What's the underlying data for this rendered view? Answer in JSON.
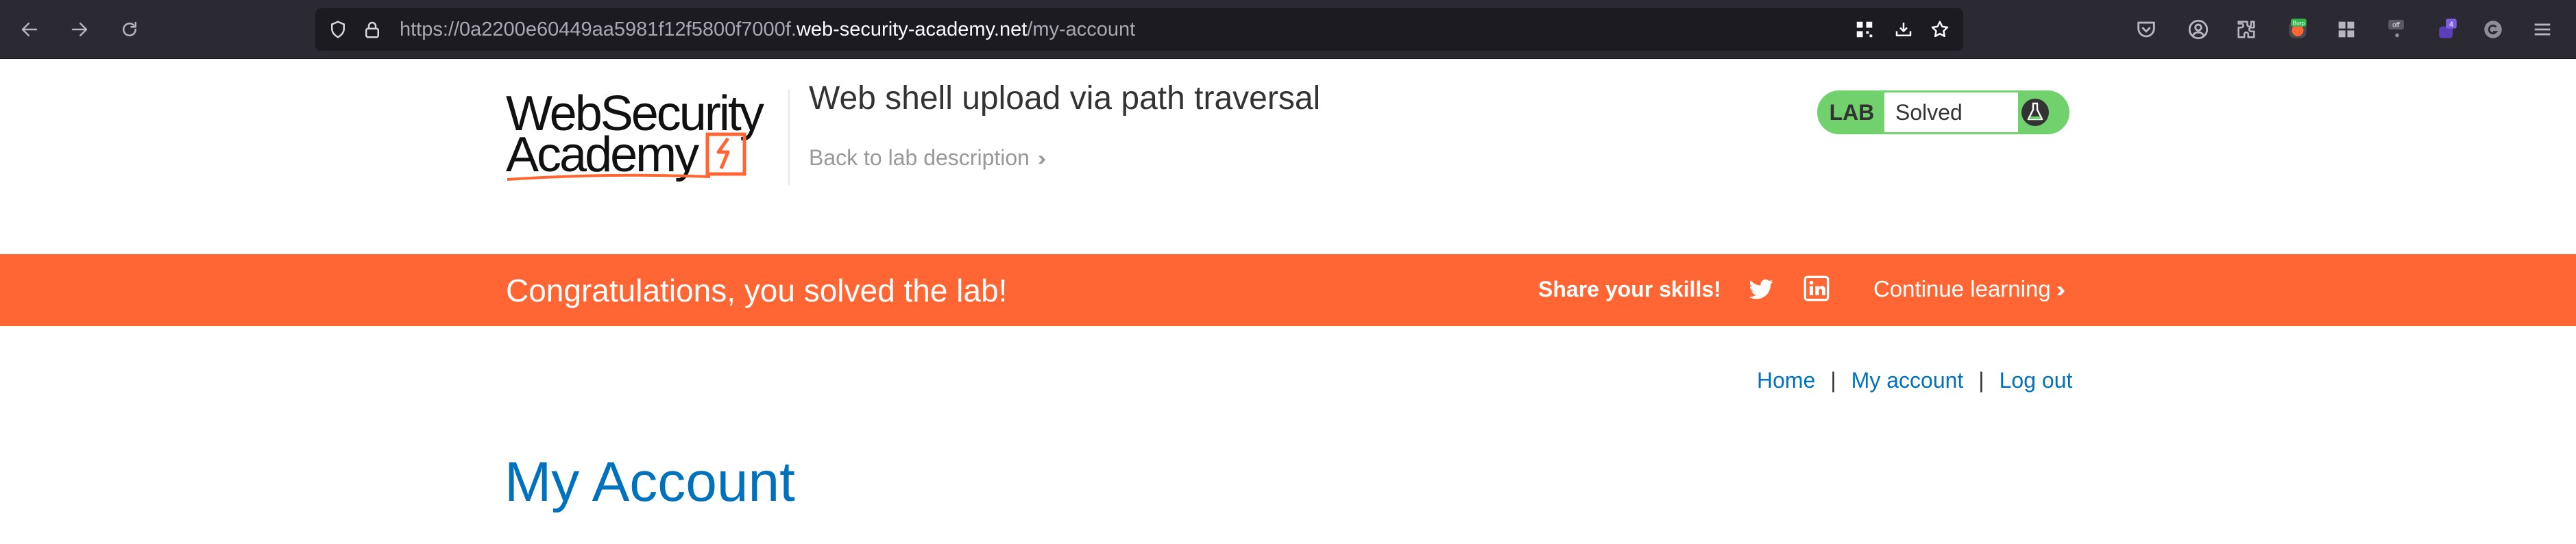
{
  "browser": {
    "url_prefix": "https://0a2200e60449aa5981f12f5800f7000f.",
    "url_domain": "web-security-academy.net",
    "url_path": "/my-account",
    "badges": {
      "burp": "Burp",
      "off": "off",
      "count": "4"
    }
  },
  "lab": {
    "logo_line1": "WebSecurity",
    "logo_line2": "Academy",
    "title": "Web shell upload via path traversal",
    "back_link": "Back to lab description",
    "status_tag": "LAB",
    "status_value": "Solved"
  },
  "banner": {
    "message": "Congratulations, you solved the lab!",
    "share_label": "Share your skills!",
    "continue_label": "Continue learning"
  },
  "nav": {
    "home": "Home",
    "separator": "|",
    "my_account": "My account",
    "log_out": "Log out"
  },
  "page": {
    "title": "My Account"
  },
  "colors": {
    "brand_orange": "#ff6633",
    "solved_green": "#70d16d",
    "link_blue": "#0071bc",
    "chrome_dark": "#2b2a33"
  }
}
